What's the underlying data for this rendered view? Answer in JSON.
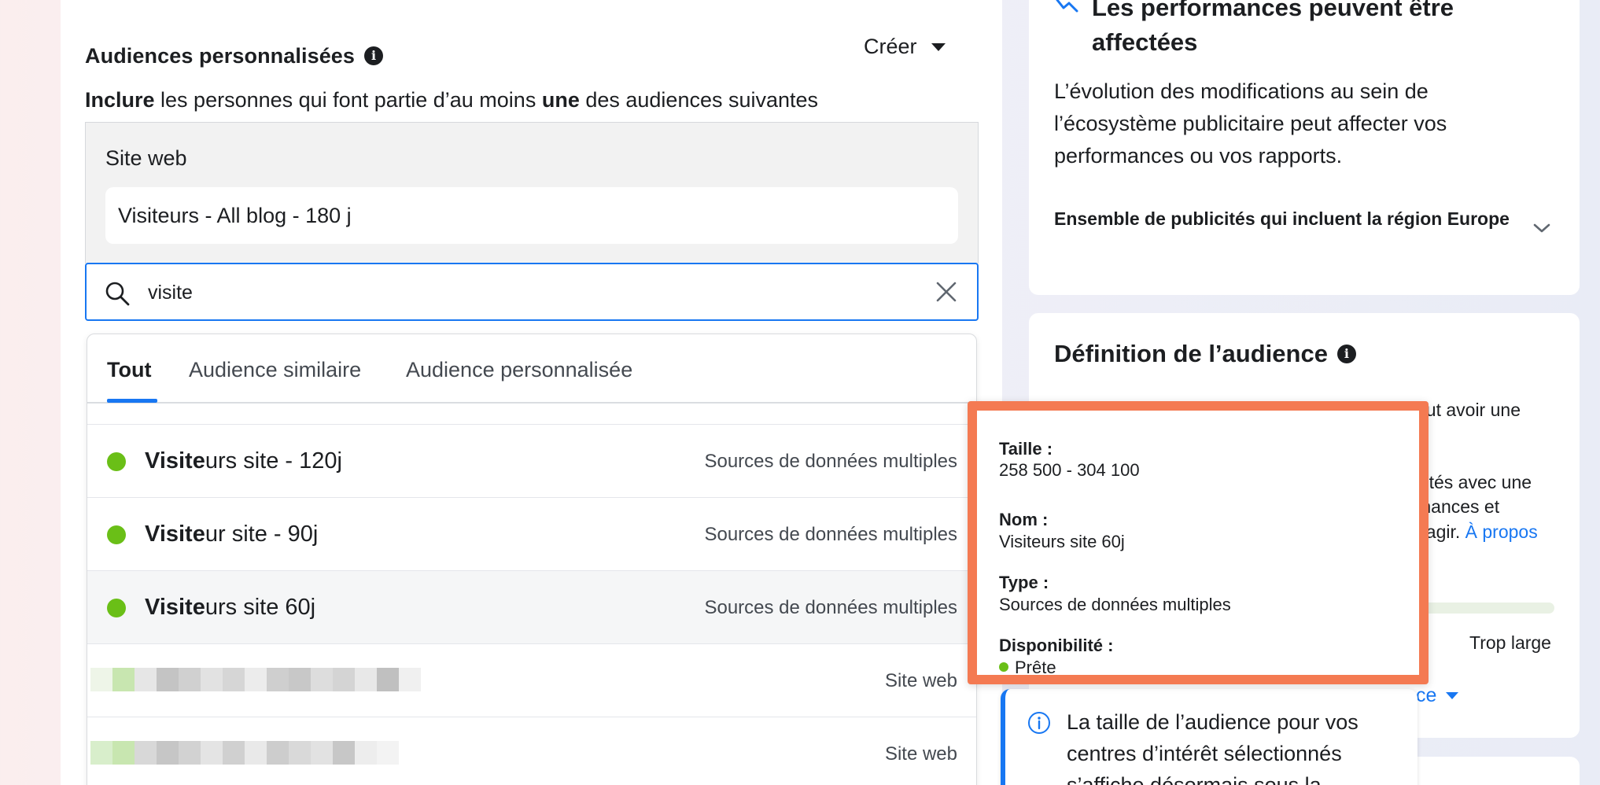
{
  "audiences": {
    "title": "Audiences personnalisées",
    "create_label": "Créer",
    "include_bold": "Inclure",
    "include_mid": " les personnes qui font partie d’au moins ",
    "include_bold2": "une",
    "include_end": " des audiences suivantes",
    "box_label": "Site web",
    "selected": "Visiteurs - All blog - 180 j"
  },
  "search": {
    "value": "visite"
  },
  "tabs": [
    {
      "label": "Tout"
    },
    {
      "label": "Audience similaire"
    },
    {
      "label": "Audience personnalisée"
    }
  ],
  "results": [
    {
      "match": "Visite",
      "rest": "urs site - 120j",
      "source": "Sources de données multiples"
    },
    {
      "match": "Visite",
      "rest": "ur site - 90j",
      "source": "Sources de données multiples"
    },
    {
      "match": "Visite",
      "rest": "urs site 60j",
      "source": "Sources de données multiples"
    },
    {
      "source": "Site web"
    },
    {
      "source": "Site web"
    }
  ],
  "tooltip": {
    "size_label": "Taille :",
    "size_value": "258 500 - 304 100",
    "name_label": "Nom :",
    "name_value": "Visiteurs site 60j",
    "type_label": "Type :",
    "type_value": "Sources de données multiples",
    "availability_label": "Disponibilité :",
    "availability_value": "Prête"
  },
  "performance": {
    "title": "Les performances peuvent être affectées",
    "body": "L’évolution des modifications au sein de l’écosystème publicitaire peut affecter vos performances ou vos rapports.",
    "collapsible": "Ensemble de publicités qui incluent la région Europe"
  },
  "definition": {
    "title": "Définition de l’audience",
    "frag1": "eut avoir une",
    "frag2": "cités avec une",
    "frag3": "mances et",
    "frag4": "éagir. ",
    "link": "À propos",
    "meter_label": "Trop large",
    "more_fragment": "ce"
  },
  "notice": {
    "text": "La taille de l’audience pour vos centres d’intérêt sélectionnés s’affiche désormais sous la"
  },
  "colors": {
    "accent": "#1877f2",
    "ready_green": "#6abf17",
    "highlight_orange": "#f47a52"
  }
}
